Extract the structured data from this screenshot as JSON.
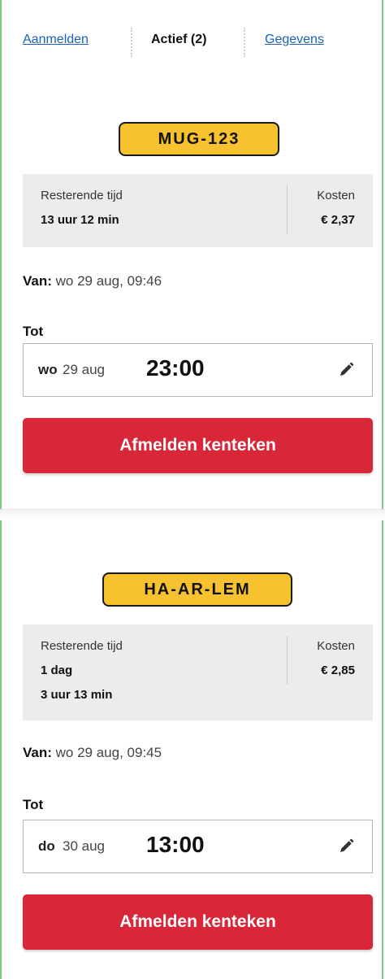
{
  "tabs": [
    {
      "label": "Aanmelden",
      "active": false
    },
    {
      "label": "Actief (2)",
      "active": true
    },
    {
      "label": "Gegevens",
      "active": false
    }
  ],
  "parkings": [
    {
      "plate": "MUG-123",
      "remaining_label": "Resterende tijd",
      "remaining_line1": "13 uur 12 min",
      "remaining_line2": "",
      "cost_label": "Kosten",
      "cost_value": "€ 2,37",
      "from_label": "Van:",
      "from_value": "wo 29 aug, 09:46",
      "until_label": "Tot",
      "until_day": "wo",
      "until_date": "29 aug",
      "until_time": "23:00",
      "edit_icon": "pencil-icon",
      "button_label": "Afmelden kenteken"
    },
    {
      "plate": "HA-AR-LEM",
      "remaining_label": "Resterende tijd",
      "remaining_line1": "1 dag",
      "remaining_line2": "3 uur 13 min",
      "cost_label": "Kosten",
      "cost_value": "€ 2,85",
      "from_label": "Van:",
      "from_value": "wo 29 aug, 09:45",
      "until_label": "Tot",
      "until_day": "do",
      "until_date": "30 aug",
      "until_time": "13:00",
      "edit_icon": "pencil-icon",
      "button_label": "Afmelden kenteken"
    }
  ],
  "colors": {
    "plate_yellow": "#f7c22f",
    "button_red": "#d9273a",
    "link_blue": "#1a63b5",
    "frame_green": "#7fc97f"
  }
}
